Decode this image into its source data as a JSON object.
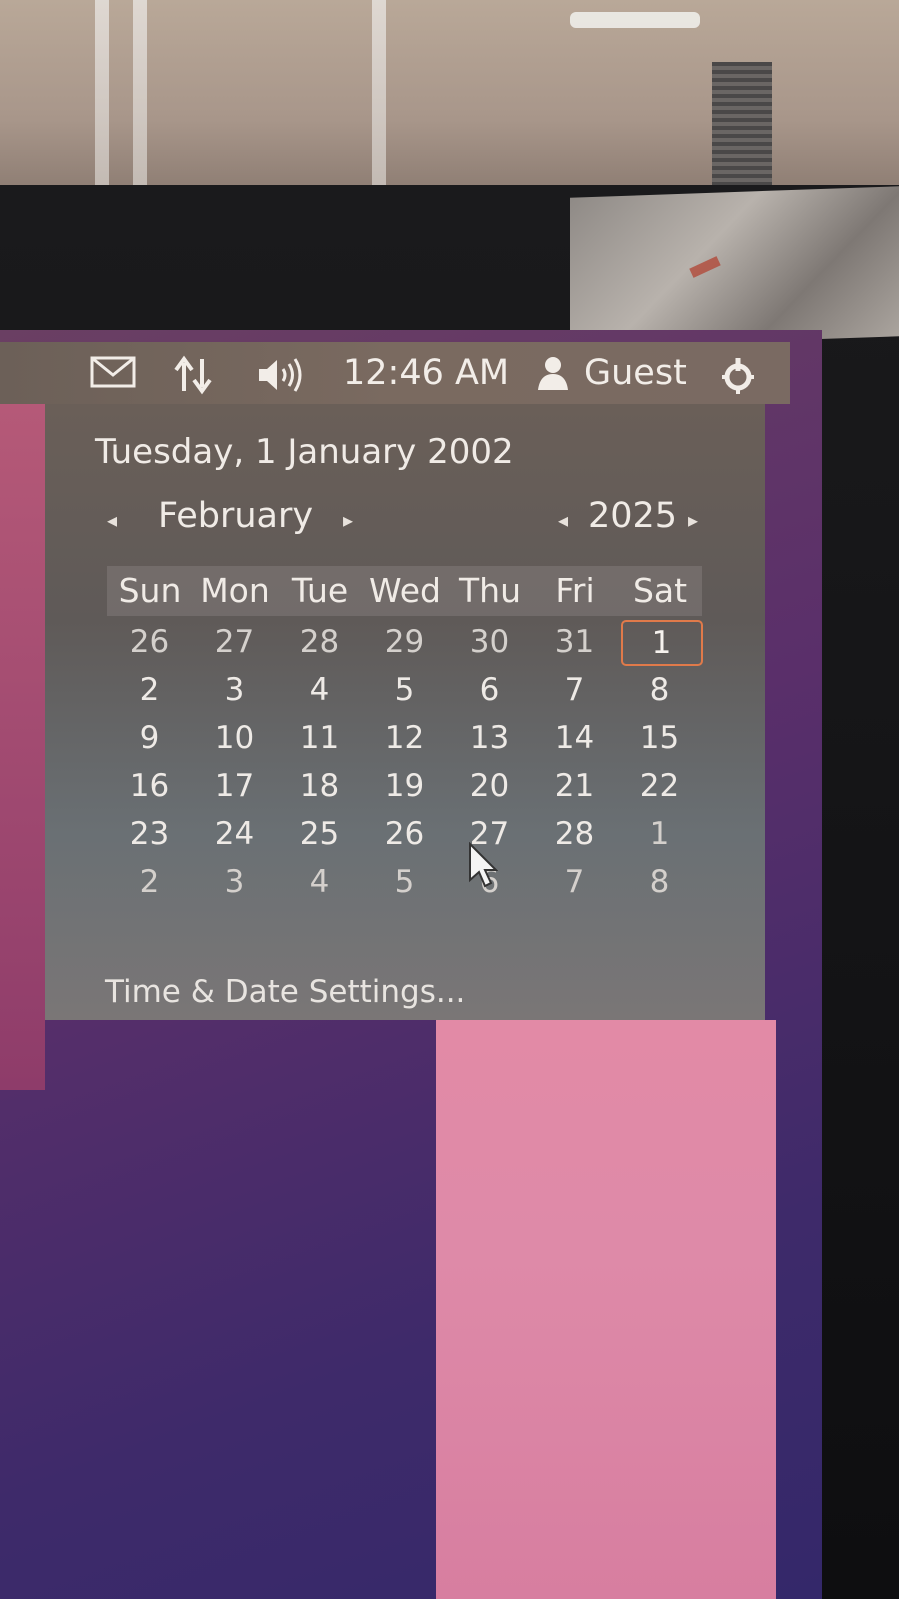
{
  "panel": {
    "clock": "12:46 AM",
    "user_name": "Guest",
    "icons": [
      "mail-icon",
      "network-icon",
      "volume-icon",
      "user-icon",
      "session-icon"
    ]
  },
  "calendar": {
    "full_date": "Tuesday,  1 January 2002",
    "month": "February",
    "year": "2025",
    "prev_arrow": "◂",
    "next_arrow": "▸",
    "weekdays": [
      "Sun",
      "Mon",
      "Tue",
      "Wed",
      "Thu",
      "Fri",
      "Sat"
    ],
    "weeks": [
      [
        "26",
        "27",
        "28",
        "29",
        "30",
        "31",
        "1"
      ],
      [
        "2",
        "3",
        "4",
        "5",
        "6",
        "7",
        "8"
      ],
      [
        "9",
        "10",
        "11",
        "12",
        "13",
        "14",
        "15"
      ],
      [
        "16",
        "17",
        "18",
        "19",
        "20",
        "21",
        "22"
      ],
      [
        "23",
        "24",
        "25",
        "26",
        "27",
        "28",
        "1"
      ],
      [
        "2",
        "3",
        "4",
        "5",
        "6",
        "7",
        "8"
      ]
    ],
    "selected_day": "1",
    "accent_color": "#e07a4a"
  },
  "menu": {
    "settings_label": "Time & Date Settings..."
  }
}
